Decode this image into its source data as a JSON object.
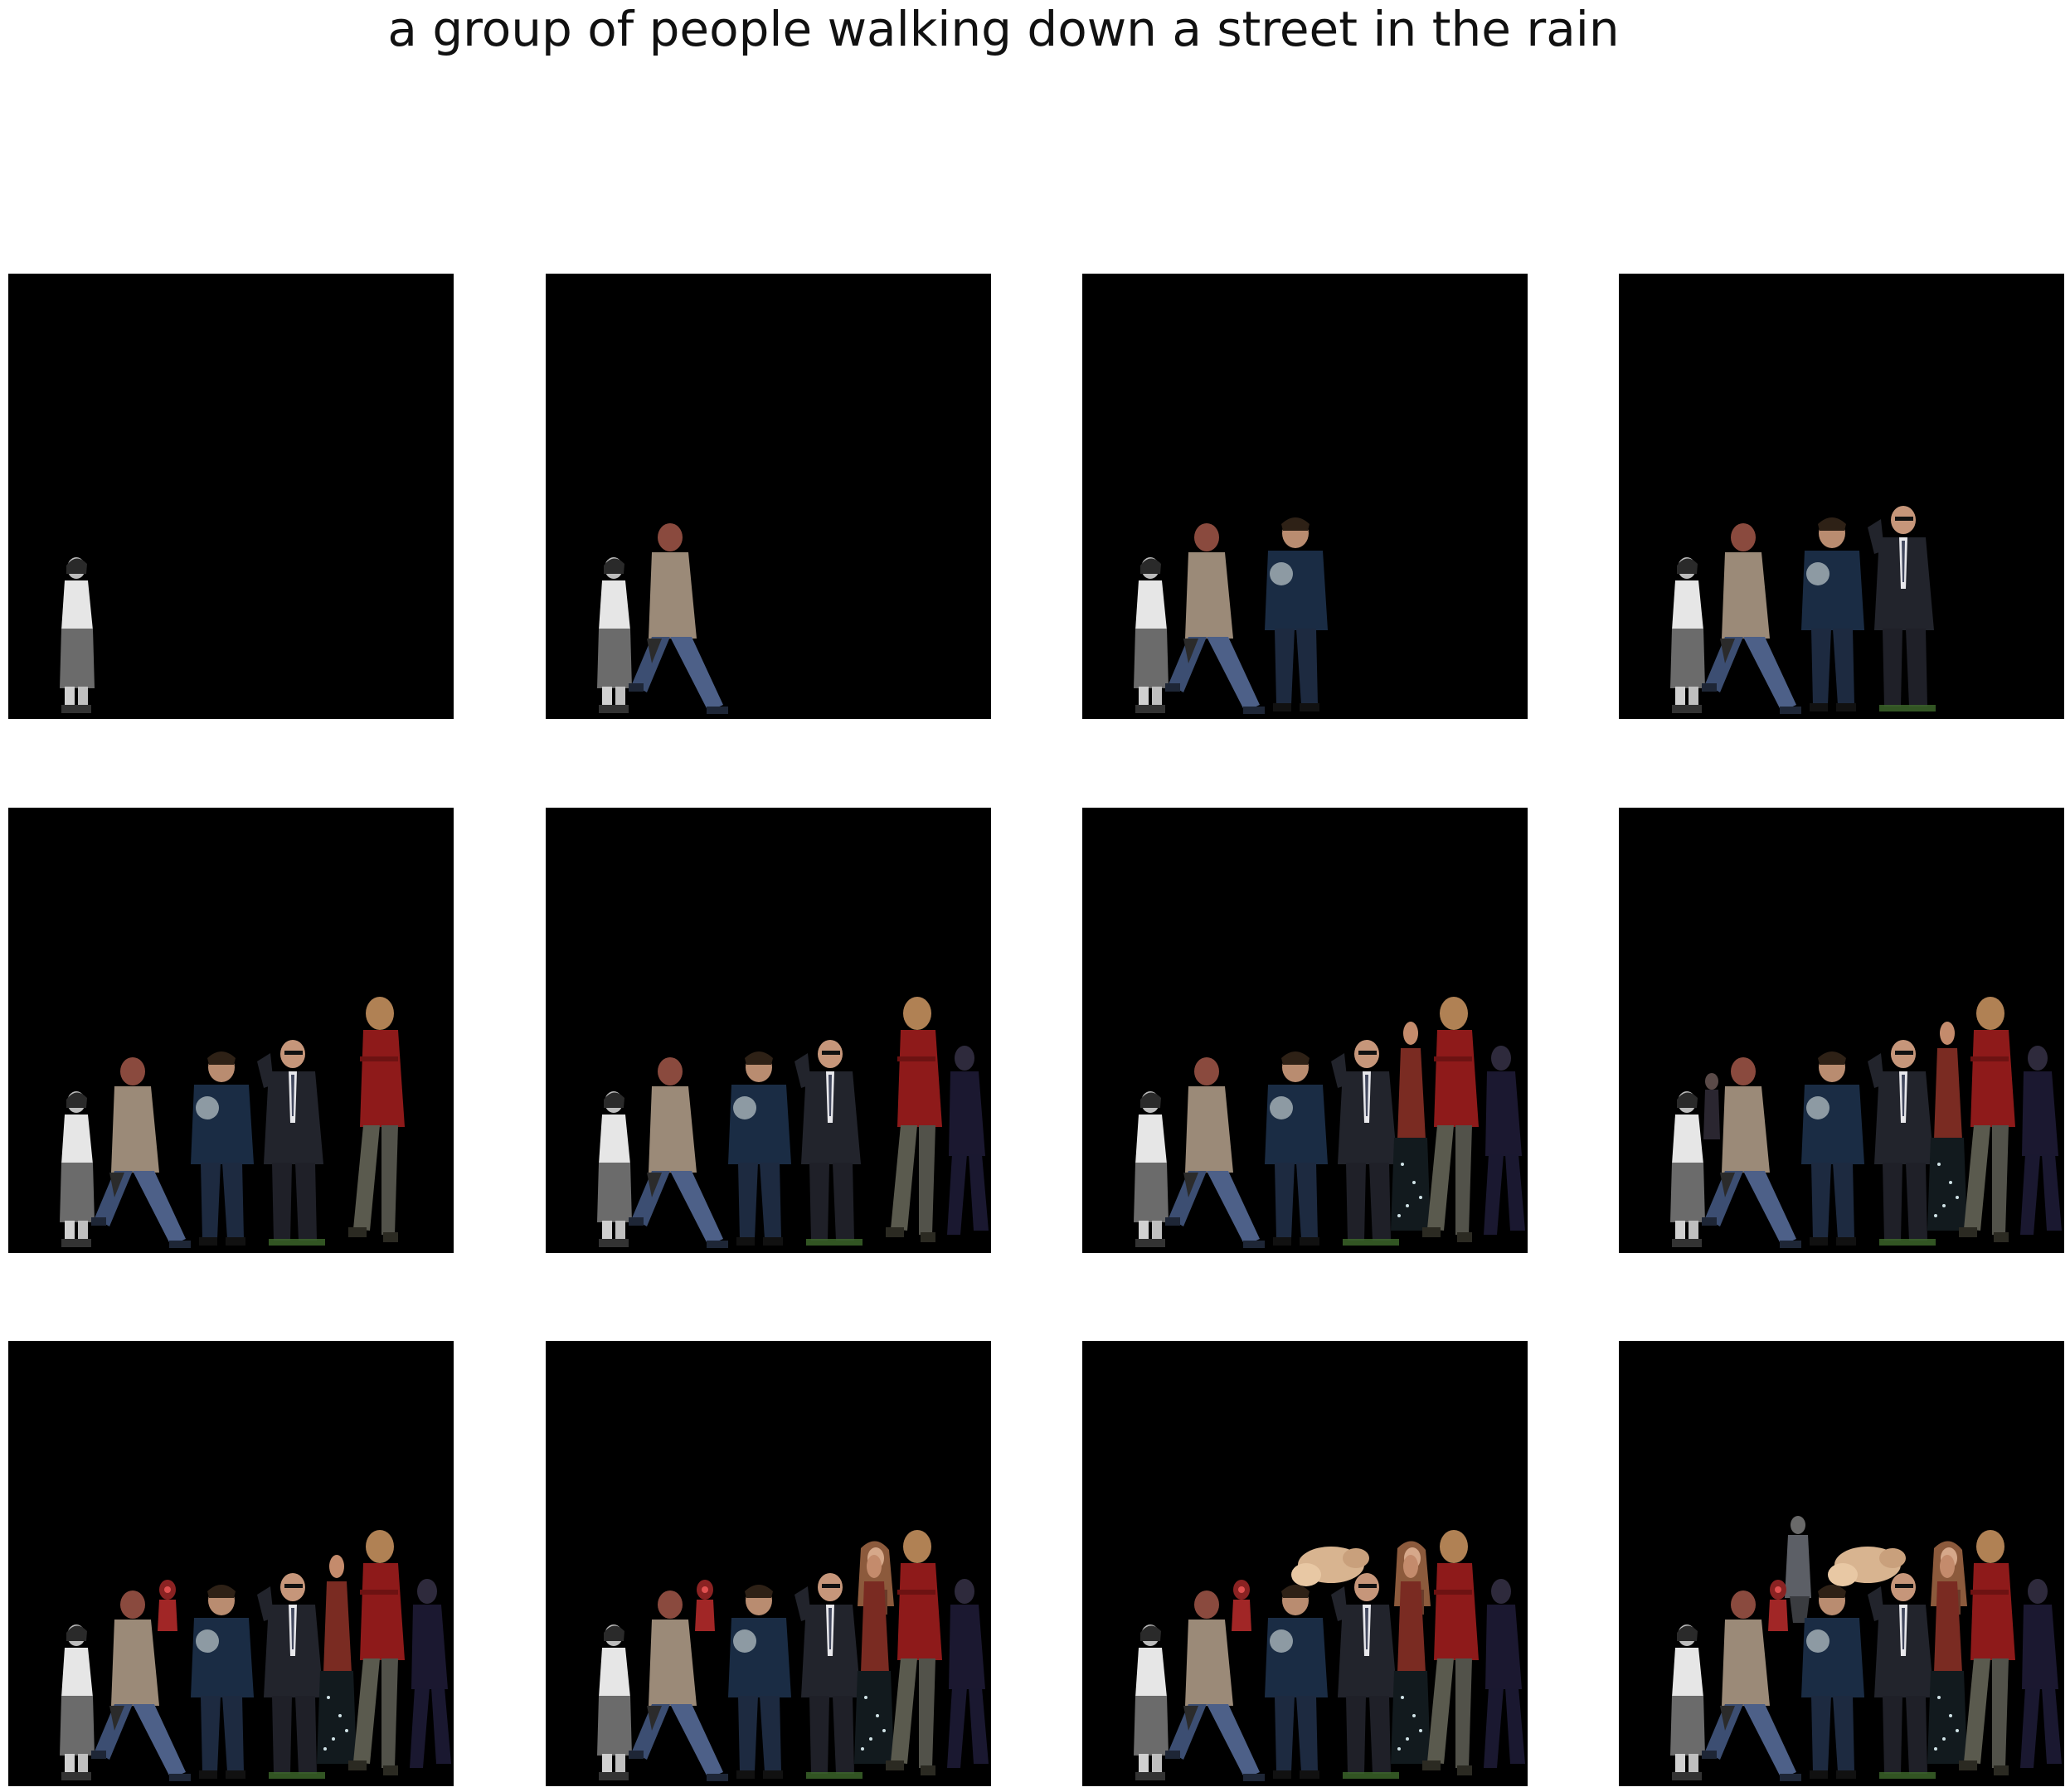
{
  "title": "a group of people walking down a street in the rain",
  "frames": [
    {
      "index": 1,
      "people": [
        "woman-white-top"
      ]
    },
    {
      "index": 2,
      "people": [
        "woman-white-top",
        "man-beige-sweater"
      ]
    },
    {
      "index": 3,
      "people": [
        "woman-white-top",
        "man-beige-sweater",
        "man-navy-jacket"
      ]
    },
    {
      "index": 4,
      "people": [
        "woman-white-top",
        "man-beige-sweater",
        "man-navy-jacket",
        "man-dark-suit"
      ]
    },
    {
      "index": 5,
      "people": [
        "woman-white-top",
        "man-beige-sweater",
        "man-navy-jacket",
        "man-dark-suit",
        "person-red-coat"
      ]
    },
    {
      "index": 6,
      "people": [
        "woman-white-top",
        "man-beige-sweater",
        "man-navy-jacket",
        "man-dark-suit",
        "person-red-coat",
        "person-dark-right"
      ]
    },
    {
      "index": 7,
      "people": [
        "woman-white-top",
        "man-beige-sweater",
        "man-navy-jacket",
        "man-dark-suit",
        "person-red-coat",
        "person-dark-right",
        "person-sparkle-dress"
      ]
    },
    {
      "index": 8,
      "people": [
        "woman-white-top",
        "man-beige-sweater",
        "man-navy-jacket",
        "man-dark-suit",
        "person-red-coat",
        "person-dark-right",
        "person-sparkle-dress",
        "small-figure-left"
      ]
    },
    {
      "index": 9,
      "people": [
        "woman-white-top",
        "man-beige-sweater",
        "man-navy-jacket",
        "man-dark-suit",
        "person-red-coat",
        "person-dark-right",
        "person-sparkle-dress",
        "small-red-figure"
      ]
    },
    {
      "index": 10,
      "people": [
        "woman-white-top",
        "man-beige-sweater",
        "man-navy-jacket",
        "man-dark-suit",
        "person-red-coat",
        "person-dark-right",
        "person-sparkle-dress",
        "small-red-figure",
        "woman-long-hair"
      ]
    },
    {
      "index": 11,
      "people": [
        "woman-white-top",
        "man-beige-sweater",
        "man-navy-jacket",
        "man-dark-suit",
        "person-red-coat",
        "person-dark-right",
        "person-sparkle-dress",
        "small-red-figure",
        "woman-long-hair",
        "blonde-curly-figure"
      ]
    },
    {
      "index": 12,
      "people": [
        "woman-white-top",
        "man-beige-sweater",
        "man-navy-jacket",
        "man-dark-suit",
        "person-red-coat",
        "person-dark-right",
        "person-sparkle-dress",
        "small-red-figure",
        "woman-long-hair",
        "blonde-curly-figure",
        "grey-figure-top"
      ]
    }
  ],
  "colors": {
    "background": "#000000",
    "page": "#ffffff",
    "white_top": "#e6e6e6",
    "beige_sweater": "#9b8a78",
    "navy_jacket": "#1a2c44",
    "dark_suit": "#22242c",
    "red_coat": "#8e1a1a",
    "denim": "#3c4e72"
  }
}
